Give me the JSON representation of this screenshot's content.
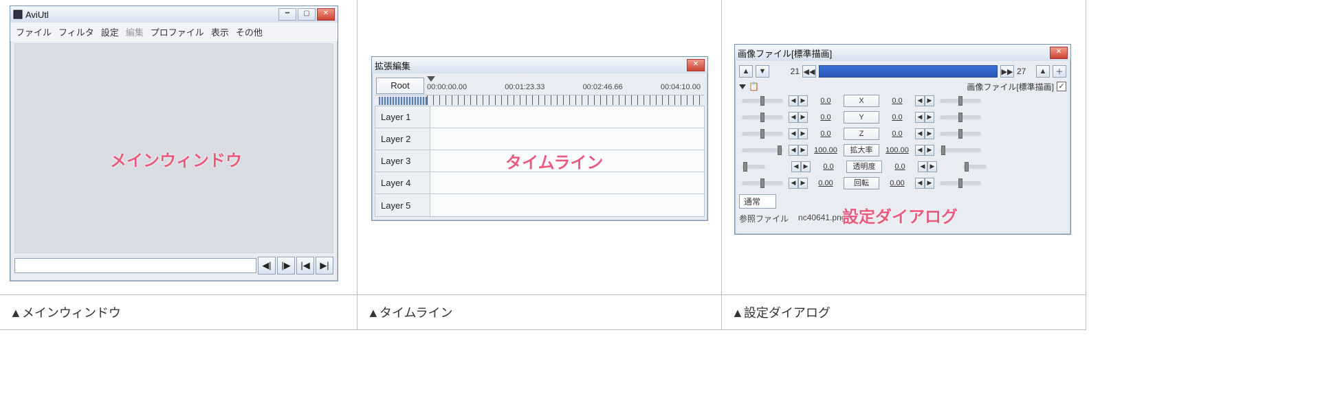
{
  "captions": {
    "main": "▲メインウィンドウ",
    "timeline": "▲タイムライン",
    "settings": "▲設定ダイアログ"
  },
  "annotations": {
    "main": "メインウィンドウ",
    "timeline": "タイムライン",
    "settings": "設定ダイアログ"
  },
  "main_window": {
    "title": "AviUtl",
    "menus": [
      "ファイル",
      "フィルタ",
      "設定",
      "編集",
      "プロファイル",
      "表示",
      "その他"
    ],
    "menu_disabled_index": 3
  },
  "timeline": {
    "title": "拡張編集",
    "root_button": "Root",
    "times": [
      "00:00:00.00",
      "00:01:23.33",
      "00:02:46.66",
      "00:04:10.00"
    ],
    "layers": [
      "Layer 1",
      "Layer 2",
      "Layer 3",
      "Layer 4",
      "Layer 5"
    ]
  },
  "settings": {
    "title": "画像ファイル[標準描画]",
    "frame_start": "21",
    "frame_end": "27",
    "subheader": "画像ファイル[標準描画]",
    "checkbox_checked": true,
    "clipboard_icon": "📋",
    "params": [
      {
        "label": "X",
        "left": "0.0",
        "right": "0.0"
      },
      {
        "label": "Y",
        "left": "0.0",
        "right": "0.0"
      },
      {
        "label": "Z",
        "left": "0.0",
        "right": "0.0"
      },
      {
        "label": "拡大率",
        "left": "100.00",
        "right": "100.00"
      },
      {
        "label": "透明度",
        "left": "0.0",
        "right": "0.0"
      },
      {
        "label": "回転",
        "left": "0.00",
        "right": "0.00"
      }
    ],
    "blend_mode": "通常",
    "file_label": "参照ファイル",
    "file_name": "nc40641.png"
  }
}
